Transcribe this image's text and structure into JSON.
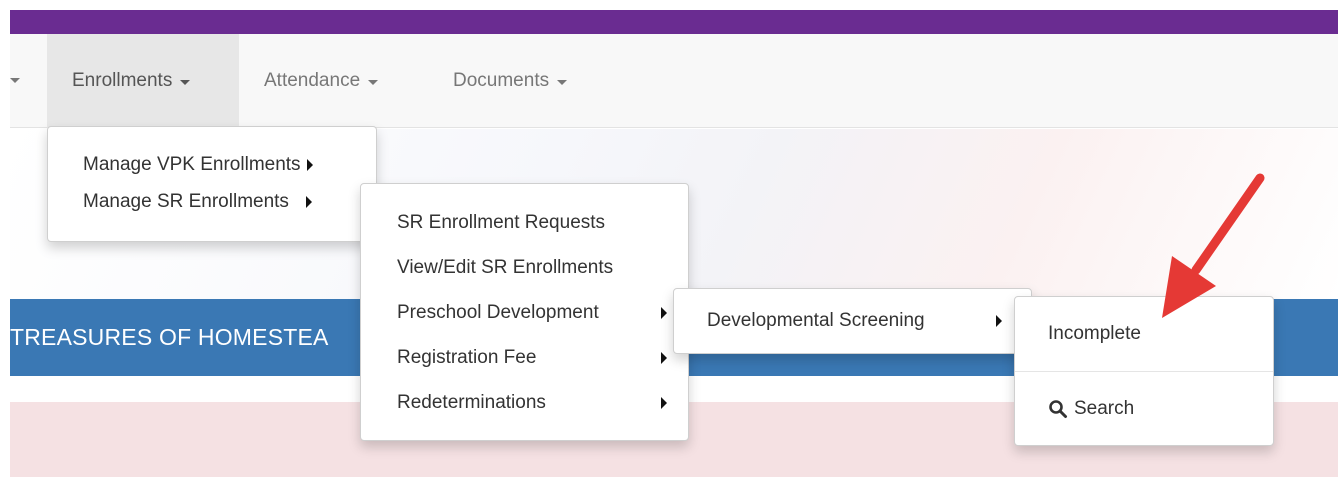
{
  "navbar": {
    "items": [
      {
        "label": "Enrollments",
        "active": true
      },
      {
        "label": "Attendance",
        "active": false
      },
      {
        "label": "Documents",
        "active": false
      }
    ]
  },
  "school": {
    "name": "TREASURES OF HOMESTEA"
  },
  "menus": {
    "enrollments": {
      "items": [
        {
          "label": "Manage VPK Enrollments"
        },
        {
          "label": "Manage SR Enrollments"
        }
      ]
    },
    "sr_enrollments": {
      "items": [
        {
          "label": "SR Enrollment Requests"
        },
        {
          "label": "View/Edit SR Enrollments"
        },
        {
          "label": "Preschool Development"
        },
        {
          "label": "Registration Fee"
        },
        {
          "label": "Redeterminations"
        }
      ]
    },
    "preschool_development": {
      "items": [
        {
          "label": "Developmental Screening"
        }
      ]
    },
    "developmental_screening": {
      "items": [
        {
          "label": "Incomplete"
        },
        {
          "label": "Search"
        }
      ]
    }
  },
  "colors": {
    "top_bar": "#6a2c91",
    "school_bar": "#3a78b4",
    "annotation_arrow": "#e53935"
  },
  "icons": {
    "submenu": "caret-right-icon",
    "dropdown": "caret-down-icon",
    "search": "search-icon"
  }
}
